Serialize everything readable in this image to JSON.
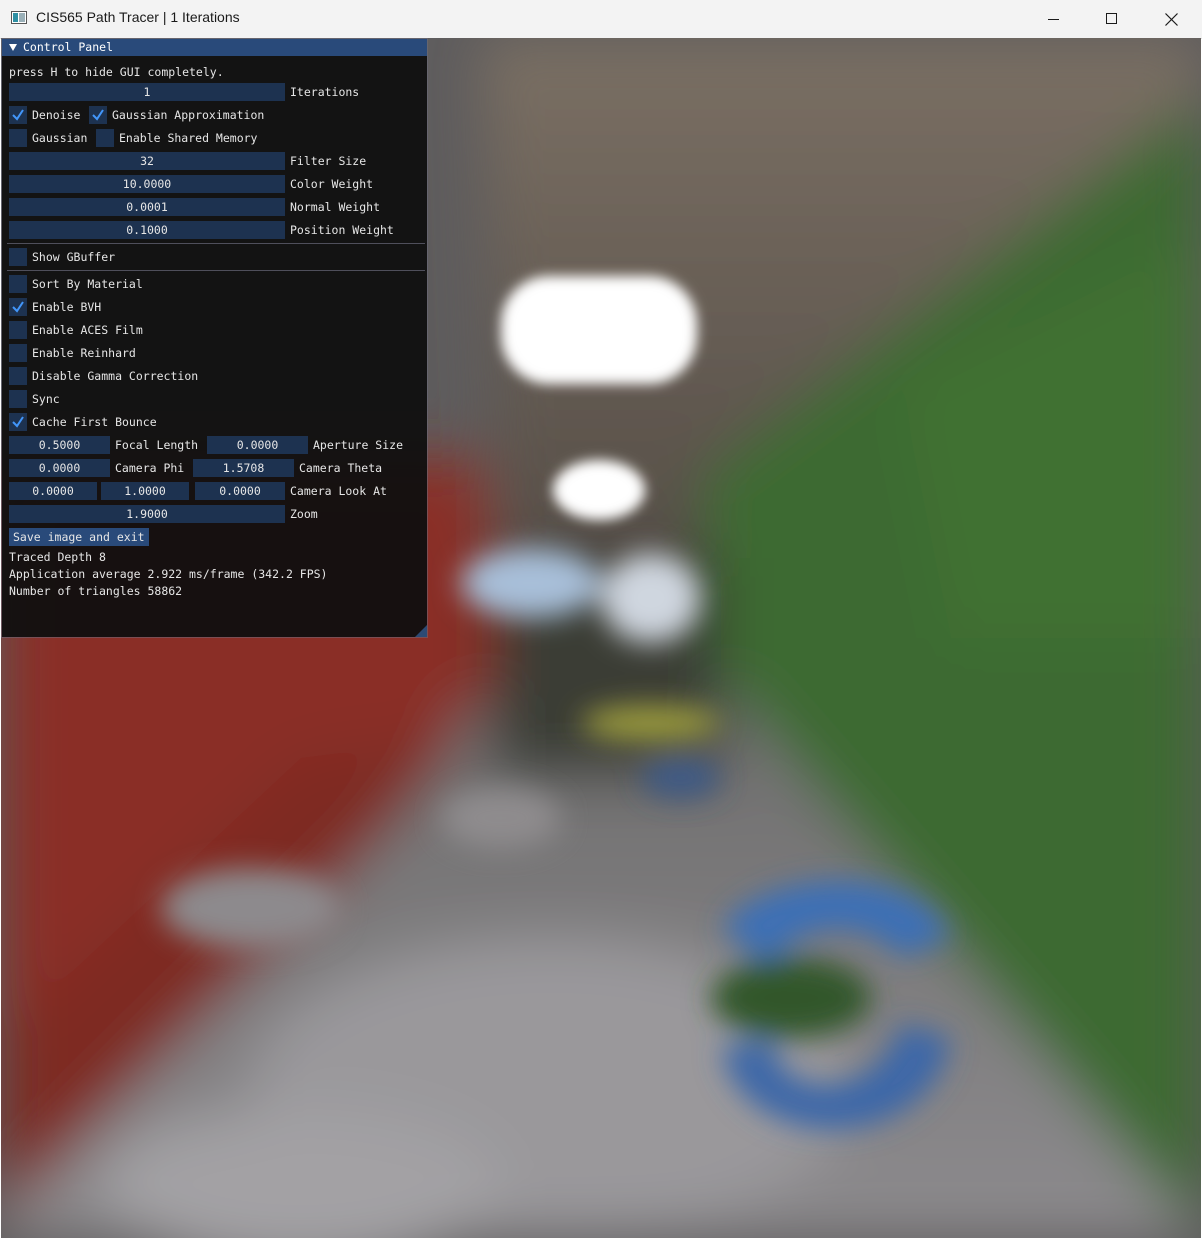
{
  "window": {
    "title": "CIS565 Path Tracer | 1 Iterations",
    "icons": {
      "minimize": "minimize-icon",
      "maximize": "maximize-icon",
      "close": "close-icon"
    }
  },
  "panel": {
    "title": "Control Panel",
    "hint": "press H to hide GUI completely.",
    "iterations": {
      "value": "1",
      "label": "Iterations"
    },
    "denoise": {
      "label": "Denoise",
      "checked": true
    },
    "gaussian_approx": {
      "label": "Gaussian Approximation",
      "checked": true
    },
    "gaussian": {
      "label": "Gaussian",
      "checked": false
    },
    "shared_memory": {
      "label": "Enable Shared Memory",
      "checked": false
    },
    "filter_size": {
      "value": "32",
      "label": "Filter Size"
    },
    "color_weight": {
      "value": "10.0000",
      "label": "Color Weight"
    },
    "normal_weight": {
      "value": "0.0001",
      "label": "Normal Weight"
    },
    "position_weight": {
      "value": "0.1000",
      "label": "Position Weight"
    },
    "show_gbuffer": {
      "label": "Show GBuffer",
      "checked": false
    },
    "sort_by_material": {
      "label": "Sort By Material",
      "checked": false
    },
    "enable_bvh": {
      "label": "Enable BVH",
      "checked": true
    },
    "enable_aces": {
      "label": "Enable ACES Film",
      "checked": false
    },
    "enable_reinhard": {
      "label": "Enable Reinhard",
      "checked": false
    },
    "disable_gamma": {
      "label": "Disable Gamma Correction",
      "checked": false
    },
    "sync": {
      "label": "Sync",
      "checked": false
    },
    "cache_first_bounce": {
      "label": "Cache First Bounce",
      "checked": true
    },
    "focal_length": {
      "value": "0.5000",
      "label": "Focal Length"
    },
    "aperture_size": {
      "value": "0.0000",
      "label": "Aperture Size"
    },
    "camera_phi": {
      "value": "0.0000",
      "label": "Camera Phi"
    },
    "camera_theta": {
      "value": "1.5708",
      "label": "Camera Theta"
    },
    "look_at": {
      "x": "0.0000",
      "y": "1.0000",
      "z": "0.0000",
      "label": "Camera Look At"
    },
    "zoom": {
      "value": "1.9000",
      "label": "Zoom"
    },
    "save_button": "Save image and exit",
    "traced_depth": "Traced Depth 8",
    "app_average": "Application average 2.922 ms/frame (342.2 FPS)",
    "triangles": "Number of triangles 58862"
  },
  "colors": {
    "panel_header": "#294a7a",
    "field_bg": "#1d3250",
    "check_mark": "#4296fa",
    "wall_red": "#8a2e26",
    "wall_green": "#3c6b30"
  }
}
